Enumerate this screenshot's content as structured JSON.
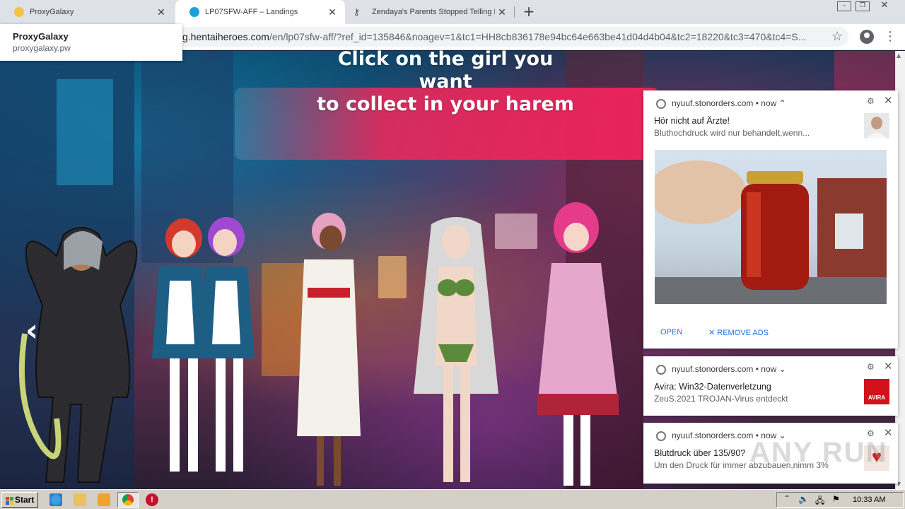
{
  "browser": {
    "tabs": [
      {
        "title": "ProxyGalaxy",
        "favicon_color": "#f4c542"
      },
      {
        "title": "LP07SFW-AFF – Landings",
        "favicon_color": "#1ea1d8"
      },
      {
        "title": "Zendaya's Parents Stopped Telling H",
        "favicon_color": "#222222"
      }
    ],
    "url_visible": "g.hentaiheroes.com",
    "url_path": "/en/lp07sfw-aff/?ref_id=135846&noagev=1&tc1=HH8cb836178e94bc64e663be41d04d4b04&tc2=18220&tc3=470&tc4=S...",
    "hover_card": {
      "title": "ProxyGalaxy",
      "domain": "proxygalaxy.pw"
    }
  },
  "page": {
    "banner_line1": "Click on the girl you want",
    "banner_line2": "to collect in your harem",
    "prev_arrow": "‹"
  },
  "notifications": [
    {
      "source": "nyuuf.stonorders.com",
      "time": "now",
      "title": "Hör nicht auf Ärzte!",
      "body": "Bluthochdruck wird nur behandelt,wenn...",
      "actions": [
        "OPEN",
        "REMOVE ADS"
      ]
    },
    {
      "source": "nyuuf.stonorders.com",
      "time": "now",
      "title": "Avira: Win32-Datenverletzung",
      "body": "ZeuS.2021 TROJAN-Virus entdeckt",
      "badge": "AVIRA"
    },
    {
      "source": "nyuuf.stonorders.com",
      "time": "now",
      "title": "Blutdruck über 135/90?",
      "body": "Um den Druck für immer abzubauen,nimm 3%"
    }
  ],
  "taskbar": {
    "start_label": "Start",
    "clock": "10:33 AM"
  },
  "watermark": "ANY RUN"
}
